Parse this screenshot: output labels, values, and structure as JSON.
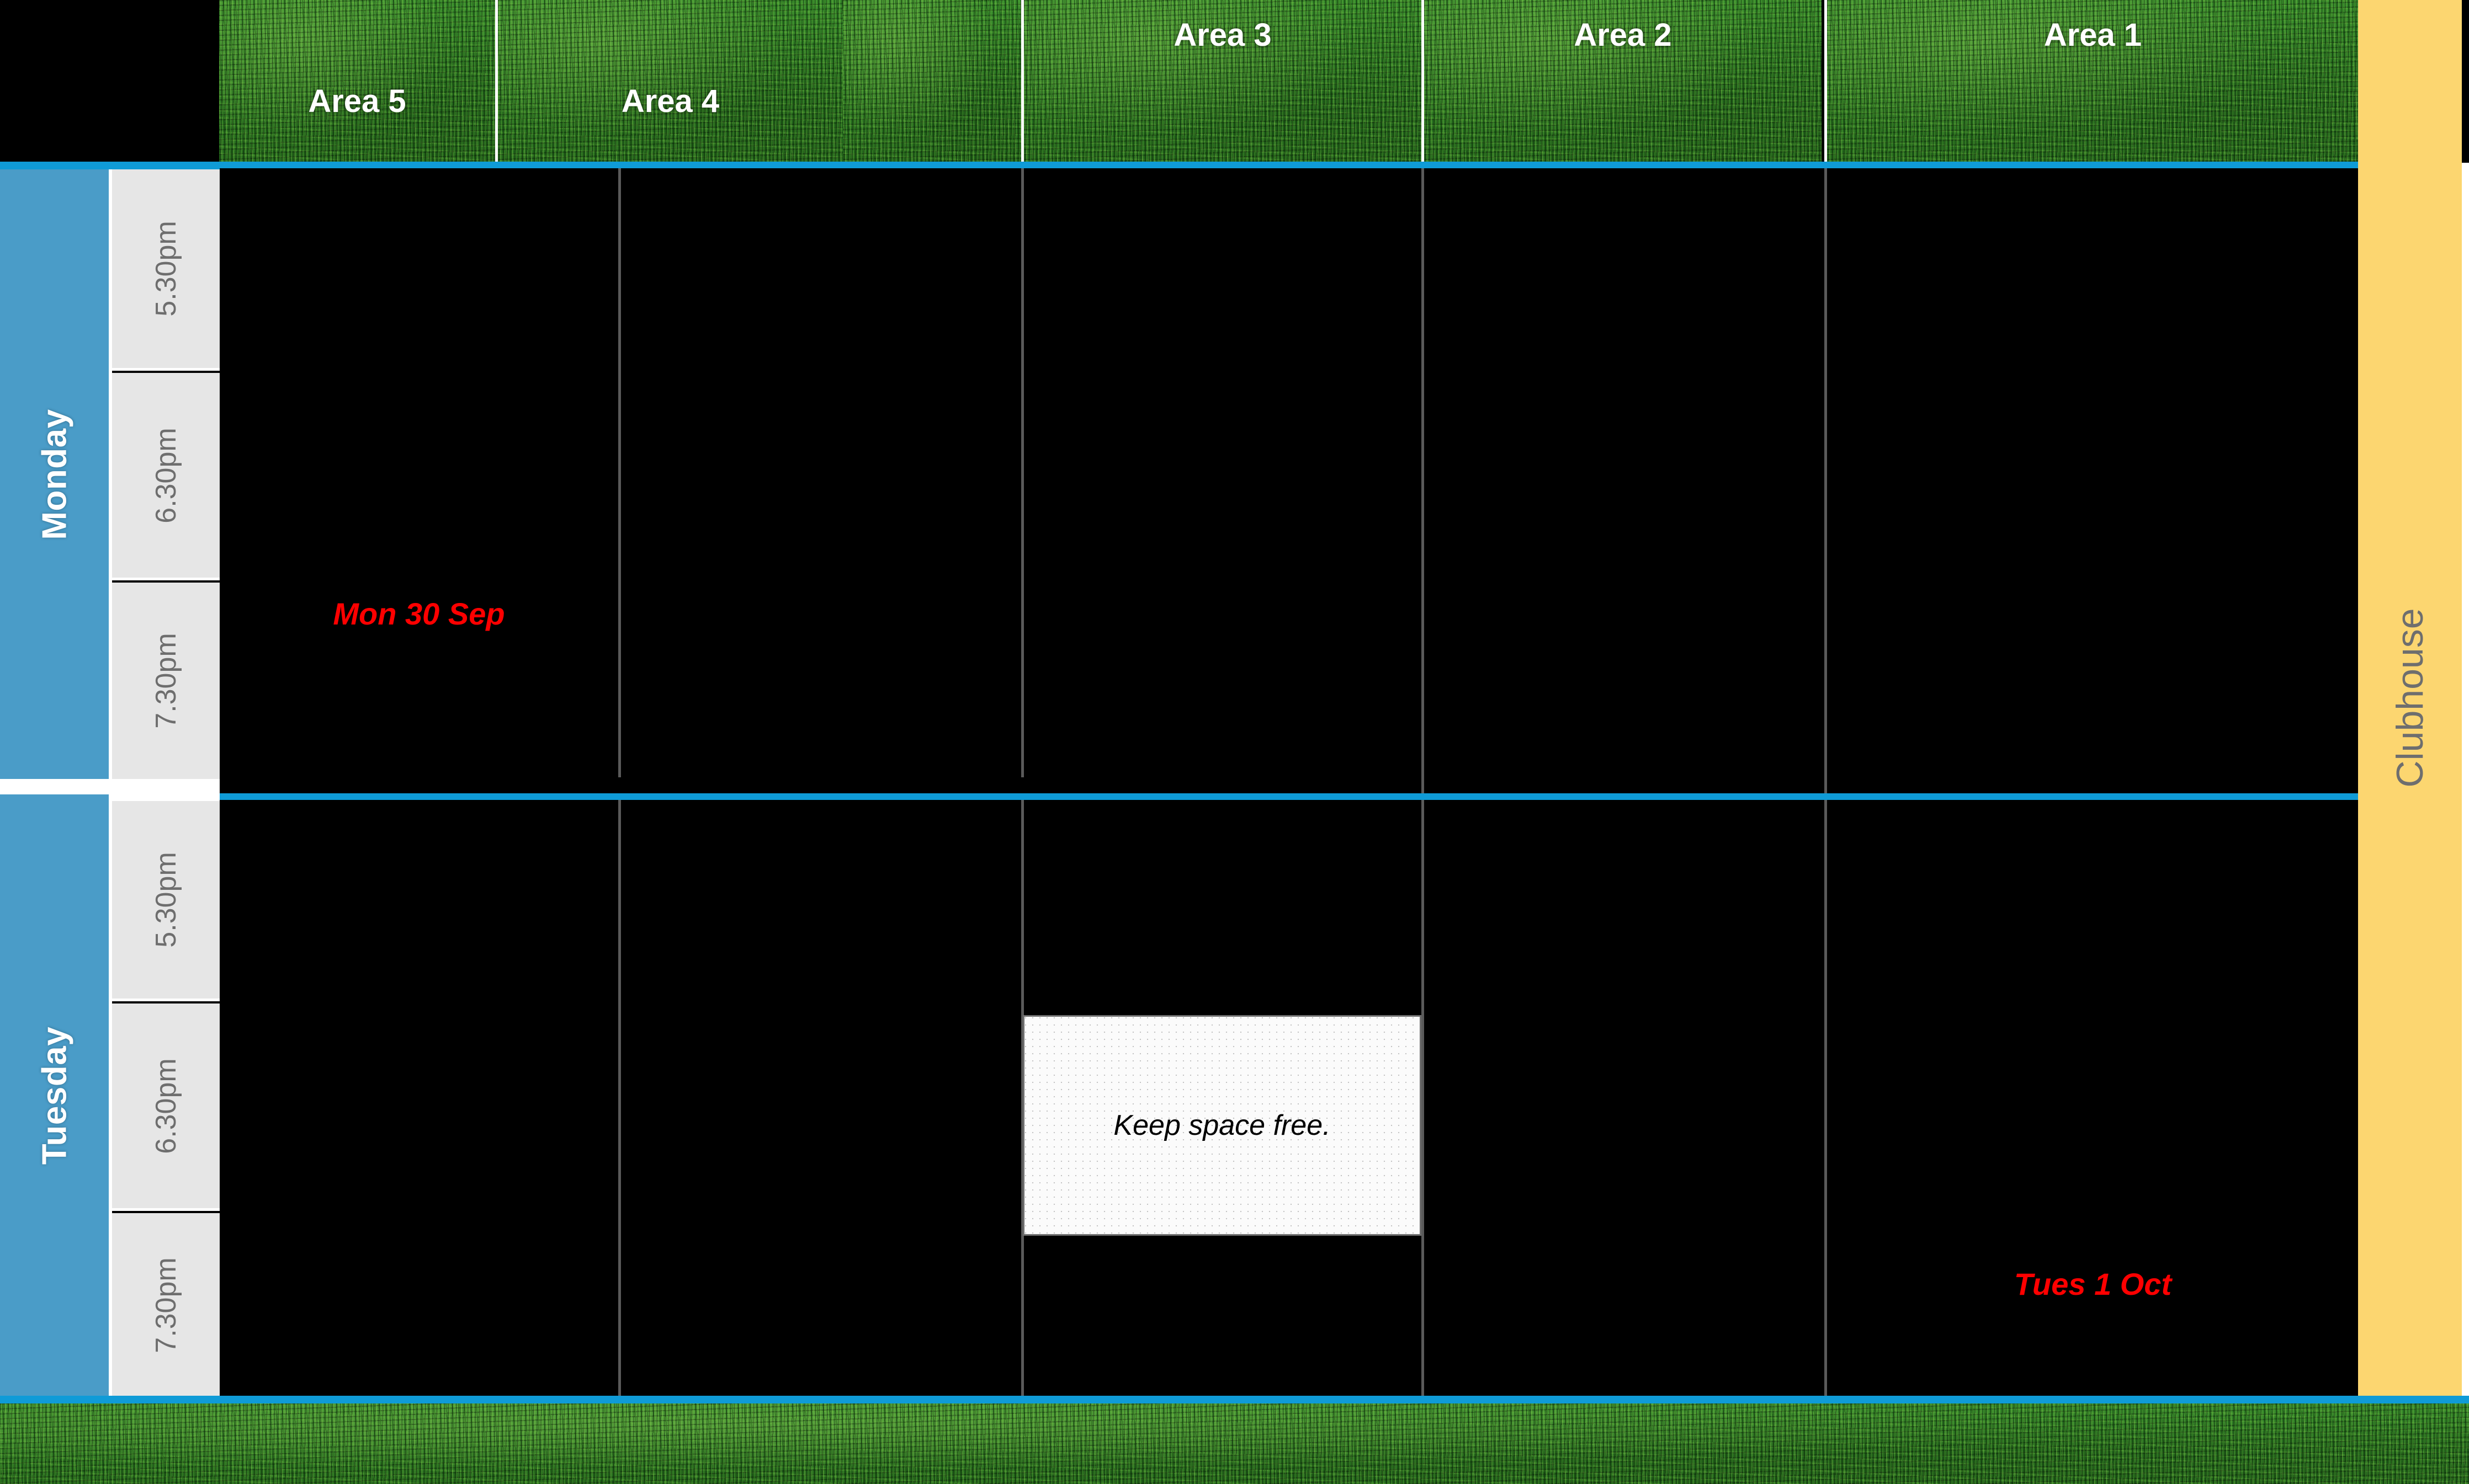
{
  "header": {
    "areas": [
      {
        "label": "Area 5",
        "align": "low"
      },
      {
        "label": "Area 4",
        "align": "low"
      },
      {
        "label": "Area 3",
        "align": "high"
      },
      {
        "label": "Area 2",
        "align": "high"
      },
      {
        "label": "Area 1",
        "align": "high"
      }
    ]
  },
  "side": {
    "days": [
      {
        "label": "Monday"
      },
      {
        "label": "Tuesday"
      }
    ],
    "times": [
      "5.30pm",
      "6.30pm",
      "7.30pm"
    ]
  },
  "notes": [
    {
      "text": "Mon 30 Sep"
    },
    {
      "text": "Tues 1 Oct"
    }
  ],
  "keep_free": {
    "text": "Keep space free."
  },
  "clubhouse": {
    "label": "Clubhouse"
  },
  "colors": {
    "accent_blue": "#0F9BD7",
    "day_blue": "#4A9CC8",
    "time_grey": "#E6E6E6",
    "clubhouse_yellow": "#FCD670",
    "note_red": "#FF0000",
    "grid_black": "#000000",
    "divider_grey": "#5A5A5A"
  }
}
